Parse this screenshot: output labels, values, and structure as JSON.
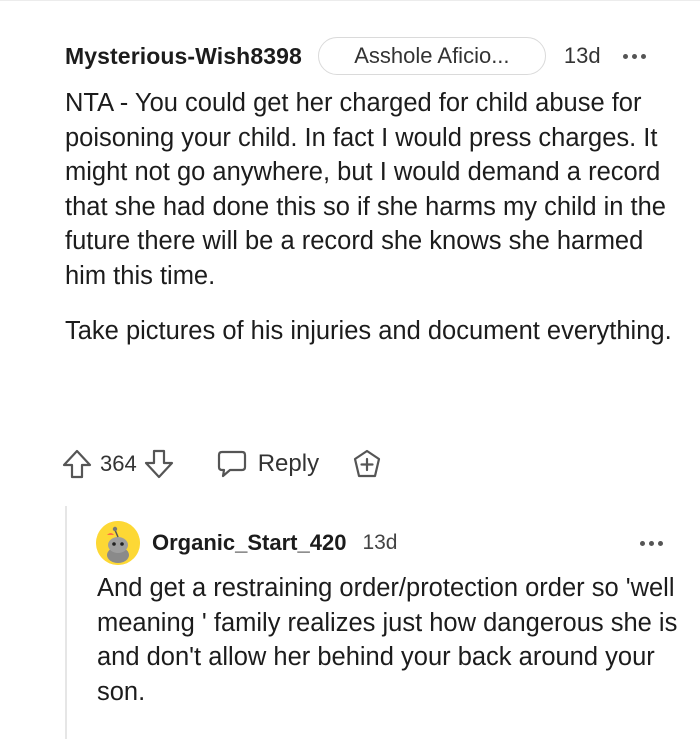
{
  "comment": {
    "author": "Mysterious-Wish8398",
    "flair": "Asshole Aficio...",
    "age": "13d",
    "paragraphs": [
      "NTA - You could get her charged for child abuse for poisoning your child. In fact I would press charges. It might not go anywhere, but I would demand a record that she had done this so if she harms my child in the future there will be a record she knows she harmed him this time.",
      "Take pictures of his injuries and document everything."
    ],
    "score": "364",
    "reply_label": "Reply",
    "icons": {
      "menu": "more-options-icon",
      "upvote": "upvote-arrow-icon",
      "downvote": "downvote-arrow-icon",
      "reply": "speech-bubble-icon",
      "award": "award-plus-icon"
    }
  },
  "reply": {
    "author": "Organic_Start_420",
    "age": "13d",
    "text": "And get a restraining order/protection order so 'well meaning ' family realizes just how dangerous she is and don't allow her behind your back around your son.",
    "avatar": "snoo-avatar",
    "avatar_color": "#fdd835"
  }
}
